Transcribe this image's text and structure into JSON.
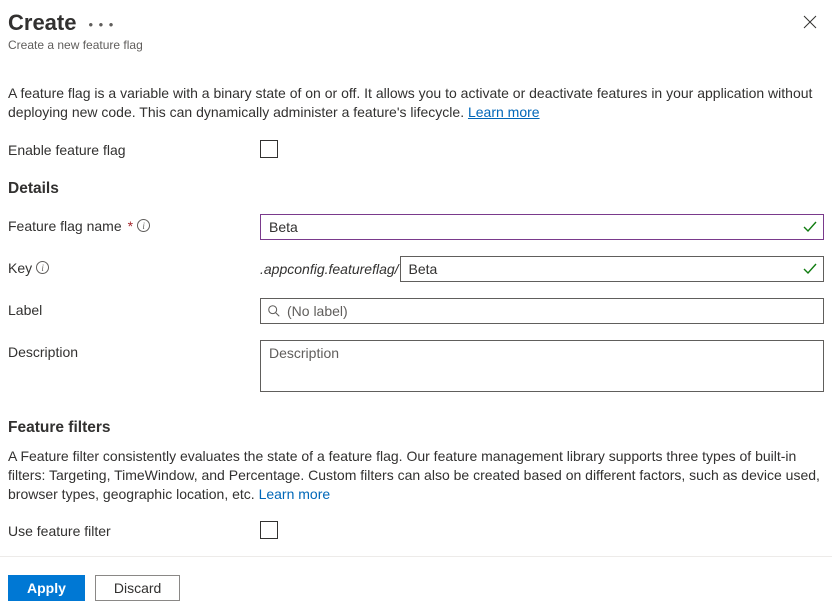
{
  "header": {
    "title": "Create",
    "subtitle": "Create a new feature flag"
  },
  "intro": {
    "text": "A feature flag is a variable with a binary state of on or off. It allows you to activate or deactivate features in your application without deploying new code. This can dynamically administer a feature's lifecycle. ",
    "learn_more": "Learn more"
  },
  "enable": {
    "label": "Enable feature flag",
    "checked": false
  },
  "details": {
    "heading": "Details",
    "name": {
      "label": "Feature flag name",
      "value": "Beta"
    },
    "key": {
      "label": "Key",
      "prefix": ".appconfig.featureflag/",
      "value": "Beta"
    },
    "labelField": {
      "label": "Label",
      "placeholder": "(No label)",
      "value": ""
    },
    "description": {
      "label": "Description",
      "placeholder": "Description",
      "value": ""
    }
  },
  "filters": {
    "heading": "Feature filters",
    "text": "A Feature filter consistently evaluates the state of a feature flag. Our feature management library supports three types of built-in filters: Targeting, TimeWindow, and Percentage. Custom filters can also be created based on different factors, such as device used, browser types, geographic location, etc. ",
    "learn_more": "Learn more",
    "use": {
      "label": "Use feature filter",
      "checked": false
    }
  },
  "footer": {
    "apply": "Apply",
    "discard": "Discard"
  }
}
